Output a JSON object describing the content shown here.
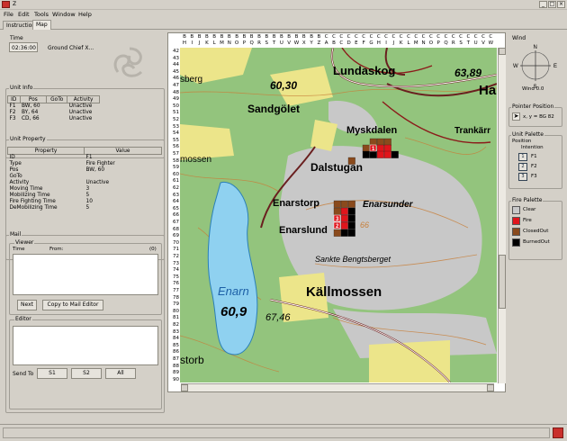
{
  "window": {
    "title": "Z"
  },
  "menu": [
    "File",
    "Edit",
    "Tools",
    "Window",
    "Help"
  ],
  "tabs": [
    {
      "label": "Instructions",
      "active": false
    },
    {
      "label": "Map",
      "active": true
    }
  ],
  "time": {
    "label": "Time",
    "value": "02:36:00",
    "role": "Ground Chief X..."
  },
  "unit_info": {
    "label": "Unit Info",
    "columns": [
      "ID",
      "Pos",
      "GoTo",
      "Activity"
    ],
    "rows": [
      {
        "id": "F1",
        "pos": "BW, 60",
        "goto": "",
        "activity": "Unactive"
      },
      {
        "id": "F2",
        "pos": "BY, 64",
        "goto": "",
        "activity": "Unactive"
      },
      {
        "id": "F3",
        "pos": "CD, 66",
        "goto": "",
        "activity": "Unactive"
      }
    ]
  },
  "unit_property": {
    "label": "Unit Property",
    "columns": [
      "Property",
      "Value"
    ],
    "rows": [
      {
        "property": "ID",
        "value": "F1"
      },
      {
        "property": "Type",
        "value": "Fire Fighter"
      },
      {
        "property": "Pos",
        "value": "BW, 60"
      },
      {
        "property": "GoTo",
        "value": ""
      },
      {
        "property": "Activity",
        "value": "Unactive"
      },
      {
        "property": "Moving Time",
        "value": "3"
      },
      {
        "property": "Mobilizing Time",
        "value": "5"
      },
      {
        "property": "Fire Fighting Time",
        "value": "10"
      },
      {
        "property": "DeMobilizing Time",
        "value": "5"
      }
    ]
  },
  "mail": {
    "label": "Mail",
    "viewer_label": "Viewer",
    "viewer_cols": {
      "time": "Time",
      "from": "From:",
      "count": "(0)"
    },
    "next_button": "Next",
    "copy_button": "Copy to Mail Editor",
    "editor_label": "Editor",
    "send_to_label": "Send To",
    "send_buttons": [
      "S1",
      "S2",
      "All"
    ]
  },
  "ruler": {
    "top_row1": [
      "B",
      "B",
      "B",
      "B",
      "B",
      "B",
      "B",
      "B",
      "B",
      "B",
      "B",
      "B",
      "B",
      "B",
      "B",
      "B",
      "B",
      "B",
      "B",
      "C",
      "C",
      "C",
      "C",
      "C",
      "C",
      "C",
      "C",
      "C",
      "C",
      "C",
      "C",
      "C",
      "C",
      "C",
      "C",
      "C",
      "C",
      "C",
      "C",
      "C",
      "C",
      "C"
    ],
    "top_row2": [
      "H",
      "I",
      "J",
      "K",
      "L",
      "M",
      "N",
      "O",
      "P",
      "Q",
      "R",
      "S",
      "T",
      "U",
      "V",
      "W",
      "X",
      "Y",
      "Z",
      "A",
      "B",
      "C",
      "D",
      "E",
      "F",
      "G",
      "H",
      "I",
      "J",
      "K",
      "L",
      "M",
      "N",
      "O",
      "P",
      "Q",
      "R",
      "S",
      "T",
      "U",
      "V",
      "W"
    ],
    "rows": [
      42,
      43,
      44,
      45,
      46,
      47,
      48,
      49,
      50,
      51,
      52,
      53,
      54,
      55,
      56,
      57,
      58,
      59,
      60,
      61,
      62,
      63,
      64,
      65,
      66,
      67,
      68,
      69,
      70,
      71,
      72,
      73,
      74,
      75,
      76,
      77,
      78,
      79,
      80,
      81,
      82,
      83,
      84,
      85,
      86,
      87,
      88,
      89,
      90
    ]
  },
  "map": {
    "place_names": [
      "Lundaskog",
      "Sandgölet",
      "Myskdalen",
      "Trankärr",
      "Dalstugan",
      "Enarstorp",
      "Enarsunder",
      "Enarslund",
      "Sankte Bengtsberget",
      "Källmossen",
      "Enarn",
      "sberg",
      "mossen",
      "storb",
      "Ha"
    ],
    "elevations": [
      "63,89",
      "60,30",
      "60,9",
      "67,46",
      "66"
    ],
    "unit_markers": [
      "3",
      "2",
      "1"
    ],
    "colors": {
      "clear": "#c8c8c8",
      "fire": "#e0151c",
      "closed_out": "#8a4a1c",
      "burned_out": "#000000"
    }
  },
  "compass": {
    "label": "Wind",
    "N": "N",
    "E": "E",
    "S": "S",
    "W": "W",
    "readout": "Wind 0.0"
  },
  "pointer": {
    "label": "Pointer Position",
    "readout": "x, y = BG 82"
  },
  "unit_palette": {
    "label": "Unit Palette",
    "position_label": "Position",
    "intention_label": "Intention",
    "items": [
      "F1",
      "F2",
      "F3"
    ]
  },
  "fire_palette": {
    "label": "Fire Palette",
    "items": [
      {
        "label": "Clear",
        "color": "#c8c8c8"
      },
      {
        "label": "Fire",
        "color": "#e0151c"
      },
      {
        "label": "ClosedOut",
        "color": "#8a4a1c"
      },
      {
        "label": "BurnedOut",
        "color": "#000000"
      }
    ]
  }
}
